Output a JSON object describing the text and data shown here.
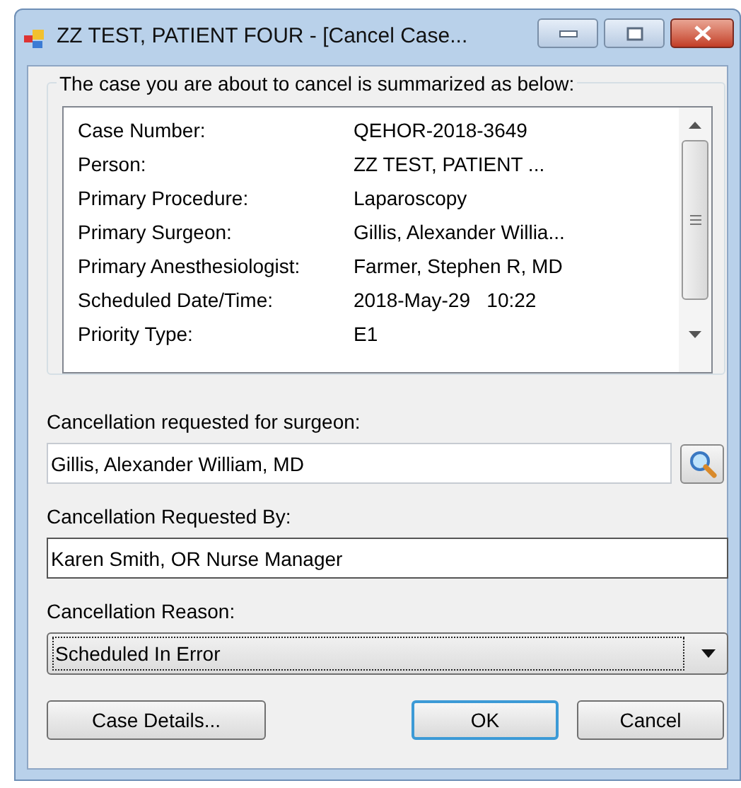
{
  "window": {
    "title": "ZZ TEST, PATIENT FOUR - [Cancel Case..."
  },
  "summary": {
    "legend": "The case you are about to cancel is summarized as below:",
    "rows": [
      {
        "label": "Case Number:",
        "value": "QEHOR-2018-3649"
      },
      {
        "label": "Person:",
        "value": "ZZ TEST, PATIENT ..."
      },
      {
        "label": "Primary Procedure:",
        "value": "Laparoscopy"
      },
      {
        "label": "Primary Surgeon:",
        "value": "Gillis, Alexander Willia..."
      },
      {
        "label": "Primary Anesthesiologist:",
        "value": "Farmer, Stephen R, MD"
      },
      {
        "label": "Scheduled Date/Time:",
        "value": "2018-May-29   10:22"
      },
      {
        "label": "Priority Type:",
        "value": "E1"
      }
    ]
  },
  "surgeon": {
    "label": "Cancellation requested for surgeon:",
    "value": "Gillis, Alexander William, MD"
  },
  "requested_by": {
    "label": "Cancellation Requested By:",
    "value": "Karen Smith, OR Nurse Manager"
  },
  "reason": {
    "label": "Cancellation Reason:",
    "value": "Scheduled In Error",
    "focused": true
  },
  "buttons": [
    {
      "label": "Case Details...",
      "default": false
    },
    {
      "label": "OK",
      "default": true
    },
    {
      "label": "Cancel",
      "default": false
    }
  ]
}
